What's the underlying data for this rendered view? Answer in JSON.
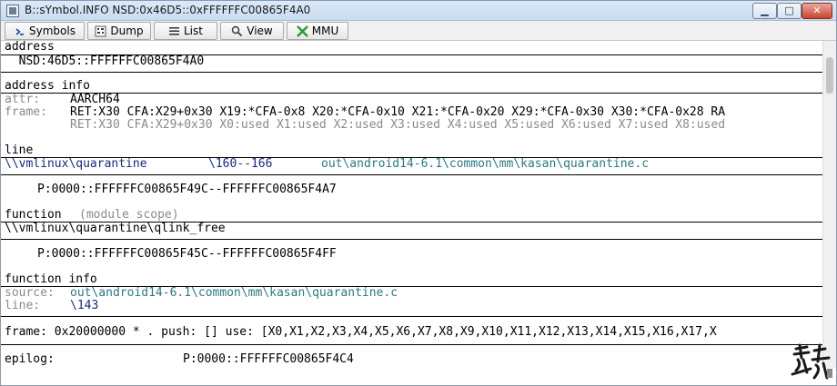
{
  "window": {
    "title": "B::sYmbol.INFO NSD:0x46D5::0xFFFFFFC00865F4A0",
    "buttons": {
      "minimize": "▁",
      "maximize": "□",
      "close": "✕"
    }
  },
  "toolbar": {
    "buttons": [
      {
        "label": "Symbols",
        "icon": "symbols-icon"
      },
      {
        "label": "Dump",
        "icon": "dump-icon"
      },
      {
        "label": "List",
        "icon": "list-icon"
      },
      {
        "label": "View",
        "icon": "magnifier-icon"
      },
      {
        "label": "MMU",
        "icon": "mmu-icon"
      }
    ]
  },
  "sections": {
    "address": {
      "header": "address",
      "value": "  NSD:46D5::FFFFFFC00865F4A0"
    },
    "address_info": {
      "header": "address info",
      "attr_label": "attr:",
      "attr_value": "AARCH64",
      "frame_label": "frame:",
      "frame_line1": "RET:X30 CFA:X29+0x30 X19:*CFA-0x8 X20:*CFA-0x10 X21:*CFA-0x20 X29:*CFA-0x30 X30:*CFA-0x28 RA",
      "frame_line2": "RET:X30 CFA:X29+0x30 X0:used X1:used X2:used X3:used X4:used X5:used X6:used X7:used X8:used"
    },
    "line": {
      "header": "line",
      "symbol": "\\\\vmlinux\\quarantine",
      "range": "\\160--166",
      "path": "out\\android14-6.1\\common\\mm\\kasan\\quarantine.c",
      "address": "P:0000::FFFFFFC00865F49C--FFFFFFC00865F4A7"
    },
    "function": {
      "header": "function",
      "scope": "(module scope)",
      "symbol": "\\\\vmlinux\\quarantine\\qlink_free",
      "address": "P:0000::FFFFFFC00865F45C--FFFFFFC00865F4FF"
    },
    "function_info": {
      "header": "function info",
      "source_label": "source:",
      "source_value": "out\\android14-6.1\\common\\mm\\kasan\\quarantine.c",
      "line_label": "line:",
      "line_value": "\\143"
    },
    "frame": {
      "text": "frame: 0x20000000 * . push: [] use: [X0,X1,X2,X3,X4,X5,X6,X7,X8,X9,X10,X11,X12,X13,X14,X15,X16,X17,X"
    },
    "epilog": {
      "label": "epilog:",
      "value": "P:0000::FFFFFFC00865F4C4"
    }
  },
  "colors": {
    "title_gradient_top": "#dce9f7",
    "gray_text": "#8a8a8a",
    "blue_text": "#1a2a7a",
    "teal_text": "#2a7a80"
  },
  "watermark": {
    "icon": "calligraphy-seal-icon"
  }
}
